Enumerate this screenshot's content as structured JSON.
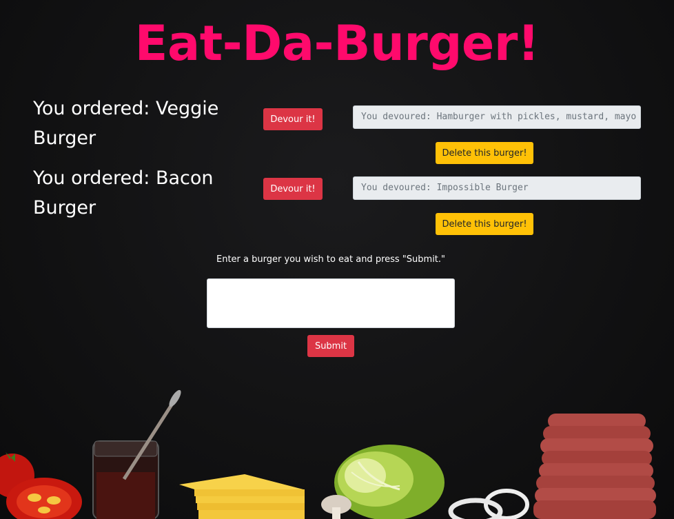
{
  "app": {
    "title": "Eat-Da-Burger!"
  },
  "orders": [
    {
      "label": "You ordered: Veggie Burger",
      "devour_label": "Devour it!"
    },
    {
      "label": "You ordered: Bacon Burger",
      "devour_label": "Devour it!"
    }
  ],
  "devoured": [
    {
      "text": "You devoured: Hamburger with pickles, mustard, mayo",
      "delete_label": "Delete this burger!"
    },
    {
      "text": "You devoured: Impossible Burger",
      "delete_label": "Delete this burger!"
    }
  ],
  "form": {
    "prompt": "Enter a burger you wish to eat and press \"Submit.\"",
    "input_value": "",
    "submit_label": "Submit"
  },
  "colors": {
    "title": "#ff0a6c",
    "devour_button": "#dc3545",
    "delete_button": "#ffc107",
    "background": "#121213"
  }
}
